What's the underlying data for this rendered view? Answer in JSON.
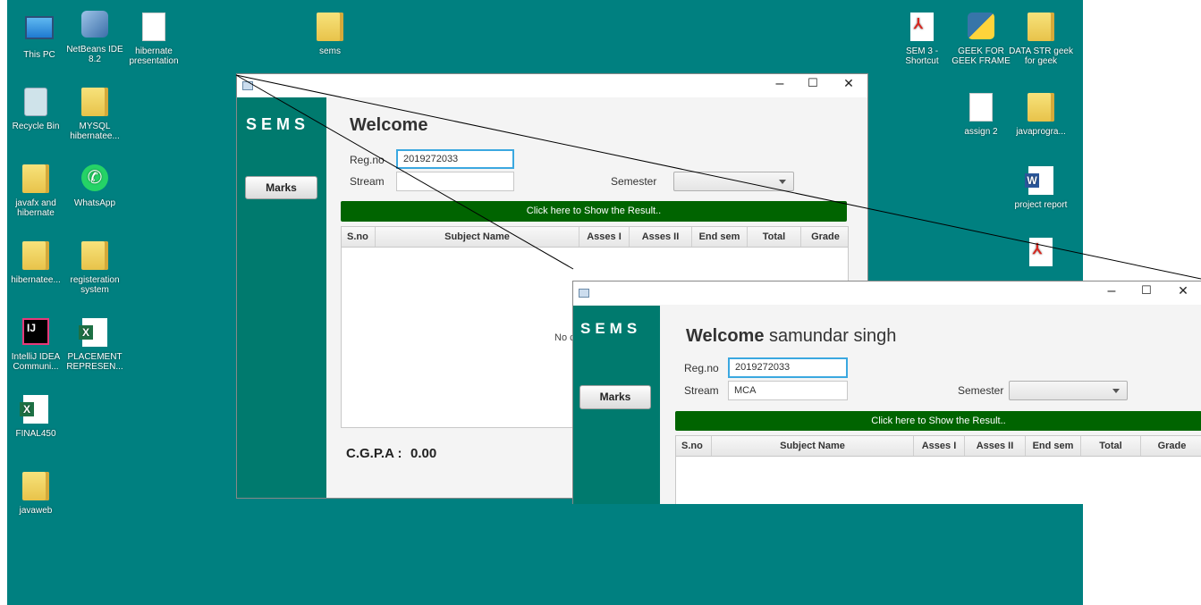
{
  "desktop": {
    "icons": [
      {
        "label": "This PC",
        "icon": "computer-icon"
      },
      {
        "label": "NetBeans IDE 8.2",
        "icon": "netbeans-icon"
      },
      {
        "label": "hibernate presentation",
        "icon": "document-icon"
      },
      {
        "label": "sems",
        "icon": "folder-icon"
      },
      {
        "label": "Recycle Bin",
        "icon": "recycle-bin-icon"
      },
      {
        "label": "MYSQL hibernatee...",
        "icon": "folder-icon"
      },
      {
        "label": "javafx and hibernate",
        "icon": "folder-icon"
      },
      {
        "label": "WhatsApp",
        "icon": "whatsapp-icon"
      },
      {
        "label": "hibernatee...",
        "icon": "folder-icon"
      },
      {
        "label": "registeration system",
        "icon": "folder-icon"
      },
      {
        "label": "IntelliJ IDEA Communi...",
        "icon": "intellij-icon"
      },
      {
        "label": "PLACEMENT REPRESEN...",
        "icon": "excel-icon"
      },
      {
        "label": "FINAL450",
        "icon": "excel-icon"
      },
      {
        "label": "javaweb",
        "icon": "folder-icon"
      },
      {
        "label": "SEM 3 - Shortcut",
        "icon": "pdf-icon"
      },
      {
        "label": "GEEK FOR GEEK FRAME",
        "icon": "python-file-icon"
      },
      {
        "label": "DATA STR geek for geek",
        "icon": "folder-icon"
      },
      {
        "label": "assign 2",
        "icon": "document-icon"
      },
      {
        "label": "javaprogra...",
        "icon": "folder-icon"
      },
      {
        "label": "project report",
        "icon": "word-icon"
      }
    ]
  },
  "back_window": {
    "logo": "SEMS",
    "marks_button": "Marks",
    "welcome": "Welcome",
    "welcome_name": "",
    "regno_label": "Reg.no",
    "regno_value": "2019272033",
    "stream_label": "Stream",
    "stream_value": "",
    "semester_label": "Semester",
    "semester_value": "",
    "result_button": "Click here to Show the Result..",
    "columns": [
      "S.no",
      "Subject Name",
      "Asses I",
      "Asses II",
      "End sem",
      "Total",
      "Grade"
    ],
    "empty_text": "No c",
    "cgpa_label": "C.G.P.A :",
    "cgpa_value": "0.00",
    "controls": {
      "minimize": "–",
      "maximize": "☐",
      "close": "✕"
    }
  },
  "front_window": {
    "logo": "SEMS",
    "marks_button": "Marks",
    "welcome": "Welcome",
    "welcome_name": "samundar singh",
    "regno_label": "Reg.no",
    "regno_value": "2019272033",
    "stream_label": "Stream",
    "stream_value": "MCA",
    "semester_label": "Semester",
    "semester_value": "",
    "result_button": "Click here to Show the Result..",
    "columns": [
      "S.no",
      "Subject Name",
      "Asses I",
      "Asses II",
      "End sem",
      "Total",
      "Grade"
    ],
    "controls": {
      "minimize": "–",
      "maximize": "☐",
      "close": "✕"
    }
  },
  "colors": {
    "desktop": "#008080",
    "sidebar": "#007a6e",
    "result_button": "#006400"
  }
}
